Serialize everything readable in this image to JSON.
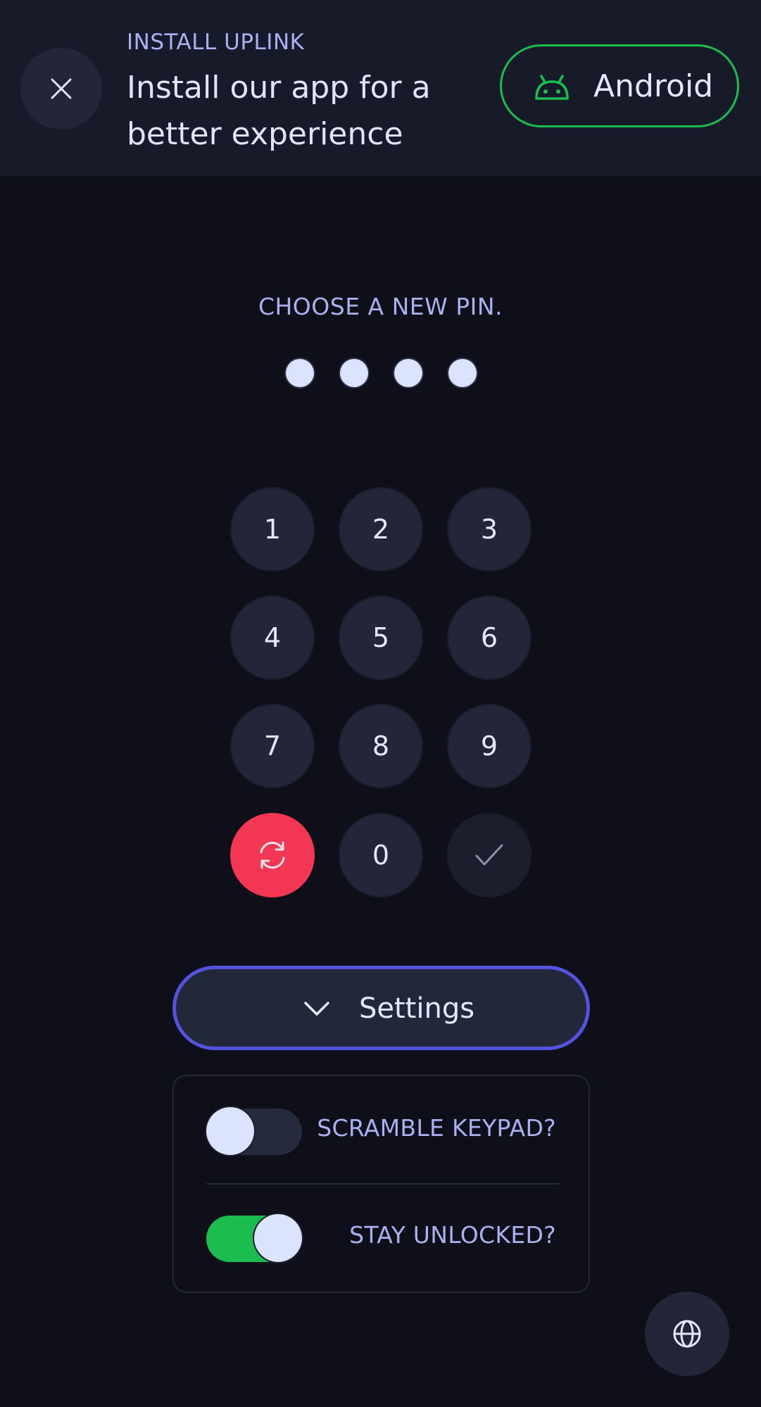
{
  "banner": {
    "eyebrow": "INSTALL UPLINK",
    "title": "Install our app for a better experience",
    "close_icon": "close-icon",
    "platform_button": {
      "label": "Android",
      "icon": "android-icon",
      "accent": "#1bbd4f"
    }
  },
  "pin": {
    "prompt": "CHOOSE A NEW PIN.",
    "dot_count": 4
  },
  "keypad": {
    "keys": [
      "1",
      "2",
      "3",
      "4",
      "5",
      "6",
      "7",
      "8",
      "9"
    ],
    "reset_icon": "refresh-icon",
    "reset_color": "#f43655",
    "zero": "0",
    "confirm_icon": "check-icon"
  },
  "settings": {
    "button_label": "Settings",
    "button_icon": "chevron-down-icon",
    "accent": "#5453e0",
    "toggles": [
      {
        "label": "SCRAMBLE KEYPAD?",
        "enabled": false
      },
      {
        "label": "STAY UNLOCKED?",
        "enabled": true,
        "color": "#1bbd4f"
      }
    ]
  },
  "language_icon": "globe-icon"
}
